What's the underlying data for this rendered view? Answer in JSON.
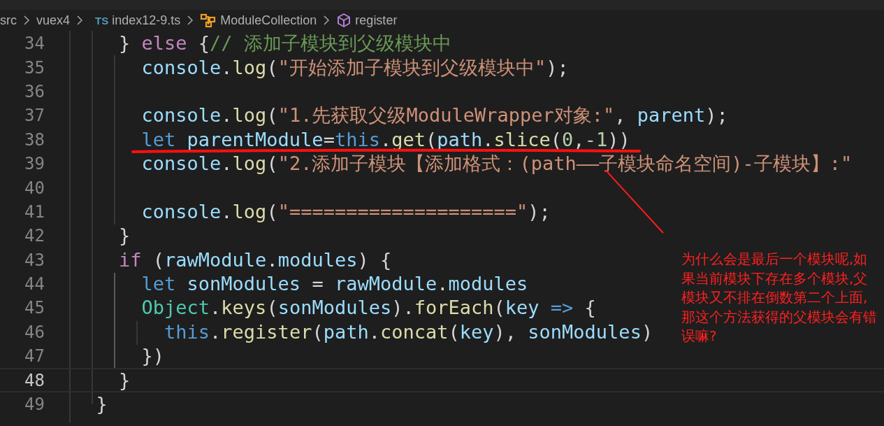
{
  "breadcrumb": [
    {
      "label": "src",
      "kind": "folder"
    },
    {
      "label": "vuex4",
      "kind": "folder"
    },
    {
      "label": "index12-9.ts",
      "kind": "file",
      "badge": "TS"
    },
    {
      "label": "ModuleCollection",
      "kind": "class"
    },
    {
      "label": "register",
      "kind": "method"
    }
  ],
  "lines": [
    {
      "number": "34",
      "current": false,
      "tokens": [
        {
          "kind": "plain",
          "t": "    } "
        },
        {
          "kind": "control",
          "t": "else"
        },
        {
          "kind": "plain",
          "t": " {"
        },
        {
          "kind": "comment",
          "t": "// 添加子模块到父级模块中"
        }
      ]
    },
    {
      "number": "35",
      "current": false,
      "tokens": [
        {
          "kind": "var",
          "t": "      console"
        },
        {
          "kind": "plain",
          "t": "."
        },
        {
          "kind": "fn",
          "t": "log"
        },
        {
          "kind": "plain",
          "t": "("
        },
        {
          "kind": "str",
          "t": "\"开始添加子模块到父级模块中\""
        },
        {
          "kind": "plain",
          "t": ");"
        }
      ]
    },
    {
      "number": "36",
      "current": false
    },
    {
      "number": "37",
      "current": false,
      "tokens": [
        {
          "kind": "var",
          "t": "      console"
        },
        {
          "kind": "plain",
          "t": "."
        },
        {
          "kind": "fn",
          "t": "log"
        },
        {
          "kind": "plain",
          "t": "("
        },
        {
          "kind": "str",
          "t": "\"1.先获取父级ModuleWrapper对象:\""
        },
        {
          "kind": "plain",
          "t": ", "
        },
        {
          "kind": "var",
          "t": "parent"
        },
        {
          "kind": "plain",
          "t": ");"
        }
      ]
    },
    {
      "number": "38",
      "current": false,
      "tokens": [
        {
          "kind": "kw",
          "t": "      let "
        },
        {
          "kind": "var",
          "t": "parentModule"
        },
        {
          "kind": "plain",
          "t": "="
        },
        {
          "kind": "kw",
          "t": "this"
        },
        {
          "kind": "plain",
          "t": "."
        },
        {
          "kind": "fn",
          "t": "get"
        },
        {
          "kind": "plain",
          "t": "("
        },
        {
          "kind": "var",
          "t": "path"
        },
        {
          "kind": "plain",
          "t": "."
        },
        {
          "kind": "fn",
          "t": "slice"
        },
        {
          "kind": "plain",
          "t": "("
        },
        {
          "kind": "num",
          "t": "0"
        },
        {
          "kind": "plain",
          "t": ","
        },
        {
          "kind": "num",
          "t": "-1"
        },
        {
          "kind": "plain",
          "t": "))"
        }
      ]
    },
    {
      "number": "39",
      "current": false,
      "tokens": [
        {
          "kind": "var",
          "t": "      console"
        },
        {
          "kind": "plain",
          "t": "."
        },
        {
          "kind": "fn",
          "t": "log"
        },
        {
          "kind": "plain",
          "t": "("
        },
        {
          "kind": "str",
          "t": "\"2.添加子模块【添加格式：(path——子模块命名空间)-子模块】:\""
        }
      ]
    },
    {
      "number": "40",
      "current": false
    },
    {
      "number": "41",
      "current": false,
      "tokens": [
        {
          "kind": "var",
          "t": "      console"
        },
        {
          "kind": "plain",
          "t": "."
        },
        {
          "kind": "fn",
          "t": "log"
        },
        {
          "kind": "plain",
          "t": "("
        },
        {
          "kind": "str",
          "t": "\"====================\""
        },
        {
          "kind": "plain",
          "t": ");"
        }
      ]
    },
    {
      "number": "42",
      "current": false,
      "tokens": [
        {
          "kind": "plain",
          "t": "    }"
        }
      ]
    },
    {
      "number": "43",
      "current": false,
      "tokens": [
        {
          "kind": "control",
          "t": "    if"
        },
        {
          "kind": "plain",
          "t": " ("
        },
        {
          "kind": "var",
          "t": "rawModule"
        },
        {
          "kind": "plain",
          "t": "."
        },
        {
          "kind": "var",
          "t": "modules"
        },
        {
          "kind": "plain",
          "t": ") {"
        }
      ]
    },
    {
      "number": "44",
      "current": false,
      "tokens": [
        {
          "kind": "kw",
          "t": "      let "
        },
        {
          "kind": "var",
          "t": "sonModules"
        },
        {
          "kind": "plain",
          "t": " = "
        },
        {
          "kind": "var",
          "t": "rawModule"
        },
        {
          "kind": "plain",
          "t": "."
        },
        {
          "kind": "var",
          "t": "modules"
        }
      ]
    },
    {
      "number": "45",
      "current": false,
      "tokens": [
        {
          "kind": "cls",
          "t": "      Object"
        },
        {
          "kind": "plain",
          "t": "."
        },
        {
          "kind": "fn",
          "t": "keys"
        },
        {
          "kind": "plain",
          "t": "("
        },
        {
          "kind": "var",
          "t": "sonModules"
        },
        {
          "kind": "plain",
          "t": ")."
        },
        {
          "kind": "fn",
          "t": "forEach"
        },
        {
          "kind": "plain",
          "t": "("
        },
        {
          "kind": "var",
          "t": "key "
        },
        {
          "kind": "kw",
          "t": "=>"
        },
        {
          "kind": "plain",
          "t": " {"
        }
      ]
    },
    {
      "number": "46",
      "current": false,
      "tokens": [
        {
          "kind": "kw",
          "t": "        this"
        },
        {
          "kind": "plain",
          "t": "."
        },
        {
          "kind": "fn",
          "t": "register"
        },
        {
          "kind": "plain",
          "t": "("
        },
        {
          "kind": "var",
          "t": "path"
        },
        {
          "kind": "plain",
          "t": "."
        },
        {
          "kind": "fn",
          "t": "concat"
        },
        {
          "kind": "plain",
          "t": "("
        },
        {
          "kind": "var",
          "t": "key"
        },
        {
          "kind": "plain",
          "t": "), "
        },
        {
          "kind": "var",
          "t": "sonModules"
        },
        {
          "kind": "plain",
          "t": ")"
        }
      ]
    },
    {
      "number": "47",
      "current": false,
      "tokens": [
        {
          "kind": "plain",
          "t": "      })"
        }
      ]
    },
    {
      "number": "48",
      "current": true,
      "tokens": [
        {
          "kind": "plain",
          "t": "    }"
        }
      ]
    },
    {
      "number": "49",
      "current": false,
      "tokens": [
        {
          "kind": "plain",
          "t": "  }"
        }
      ]
    }
  ],
  "annotation": "为什么会是最后一个模块呢,如果当前模块下存在多个模块,父模块又不排在倒数第二个上面,那这个方法获得的父模块会有错误嘛?"
}
